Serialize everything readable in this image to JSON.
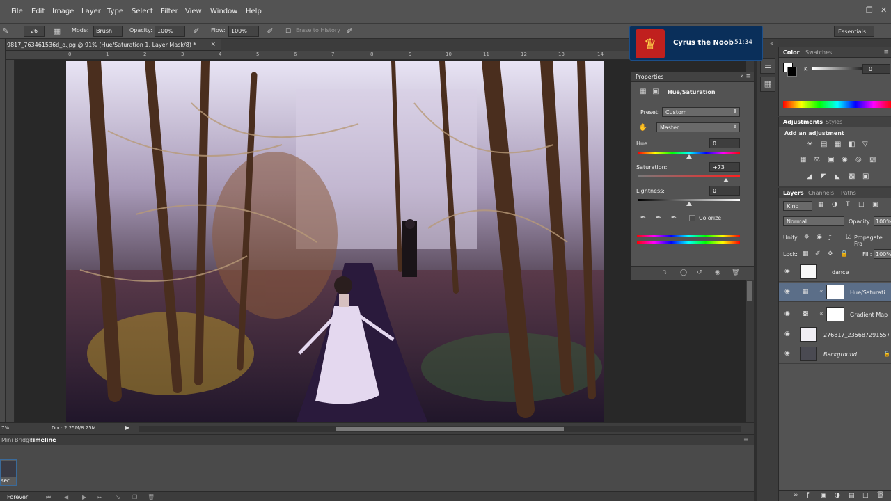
{
  "menu": [
    "File",
    "Edit",
    "Image",
    "Layer",
    "Type",
    "Select",
    "Filter",
    "View",
    "Window",
    "Help"
  ],
  "options": {
    "brush_size": "26",
    "mode_label": "Mode:",
    "mode_value": "Brush",
    "opacity_label": "Opacity:",
    "opacity_value": "100%",
    "flow_label": "Flow:",
    "flow_value": "100%",
    "erase_history": "Erase to History",
    "workspace": "Essentials"
  },
  "document": {
    "tab_title": "9817_763461536d_o.jpg @ 91% (Hue/Saturation 1, Layer Mask/8) *",
    "ruler_ticks": [
      "0",
      "1",
      "2",
      "3",
      "4",
      "5",
      "6",
      "7",
      "8",
      "9",
      "10",
      "11",
      "12",
      "13",
      "14"
    ],
    "zoom": "7%",
    "doc_size": "Doc: 2.25M/8.25M"
  },
  "timeline": {
    "tabs": [
      "Mini Bridge",
      "Timeline"
    ],
    "frame_delay": "sec.",
    "loop": "Forever"
  },
  "badge": {
    "name": "Cyrus the Noob",
    "time": "51:34"
  },
  "properties": {
    "title": "Properties",
    "adjustment_name": "Hue/Saturation",
    "preset_label": "Preset:",
    "preset_value": "Custom",
    "channel_value": "Master",
    "hue_label": "Hue:",
    "hue_value": "0",
    "saturation_label": "Saturation:",
    "saturation_value": "+73",
    "lightness_label": "Lightness:",
    "lightness_value": "0",
    "colorize_label": "Colorize"
  },
  "color_panel": {
    "tabs": [
      "Color",
      "Swatches"
    ],
    "k_label": "K",
    "k_value": "0"
  },
  "adjustments_panel": {
    "tabs": [
      "Adjustments",
      "Styles"
    ],
    "heading": "Add an adjustment"
  },
  "layers_panel": {
    "tabs": [
      "Layers",
      "Channels",
      "Paths"
    ],
    "filter_kind": "Kind",
    "blend_mode": "Normal",
    "opacity_label": "Opacity:",
    "opacity_value": "100%",
    "unify_label": "Unify:",
    "propagate_label": "Propagate Fra",
    "lock_label": "Lock:",
    "fill_label": "Fill:",
    "fill_value": "100%",
    "layers": [
      {
        "name": "dance"
      },
      {
        "name": "Hue/Saturati..."
      },
      {
        "name": "Gradient Map 1"
      },
      {
        "name": "276817_235687291557..."
      },
      {
        "name": "Background"
      }
    ]
  },
  "colors": {
    "selected_layer": "#5b6e88",
    "panel_bg": "#535353",
    "badge_bg": "#0a2f5a",
    "badge_emblem": "#c0201e"
  }
}
